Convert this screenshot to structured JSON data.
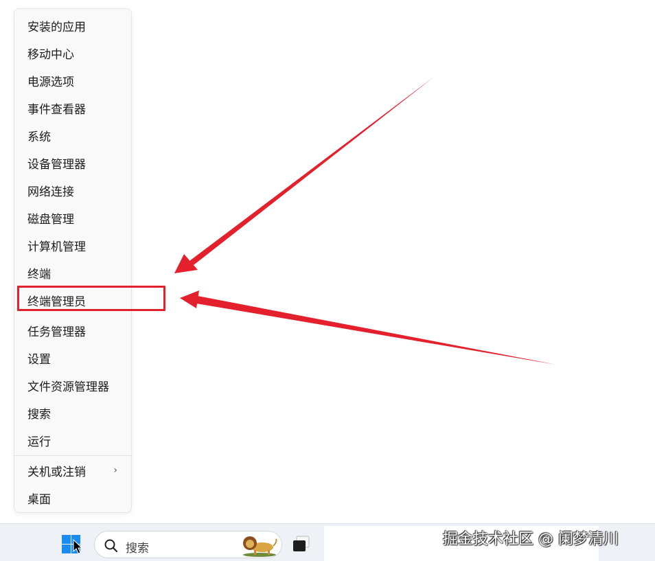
{
  "menu": {
    "items": [
      {
        "label": "安装的应用"
      },
      {
        "label": "移动中心"
      },
      {
        "label": "电源选项"
      },
      {
        "label": "事件查看器"
      },
      {
        "label": "系统"
      },
      {
        "label": "设备管理器"
      },
      {
        "label": "网络连接"
      },
      {
        "label": "磁盘管理"
      },
      {
        "label": "计算机管理"
      },
      {
        "label": "终端"
      },
      {
        "label": "终端管理员"
      },
      {
        "label": "任务管理器"
      },
      {
        "label": "设置"
      },
      {
        "label": "文件资源管理器"
      },
      {
        "label": "搜索"
      },
      {
        "label": "运行"
      },
      {
        "label": "关机或注销",
        "has_submenu": true
      },
      {
        "label": "桌面"
      }
    ],
    "highlighted_item": "终端管理员",
    "submenu_chevron": "›"
  },
  "annotation": {
    "color": "#e3202b",
    "icons": [
      "arrow-icon",
      "arrow-icon"
    ]
  },
  "taskbar": {
    "start_icon": "windows-logo-icon",
    "search_placeholder": "搜索",
    "search_icon": "search-icon",
    "lion_icon": "lion-icon",
    "task_view_icon": "task-view-icon"
  },
  "watermark": "掘金技术社区 @ 阑梦清川"
}
